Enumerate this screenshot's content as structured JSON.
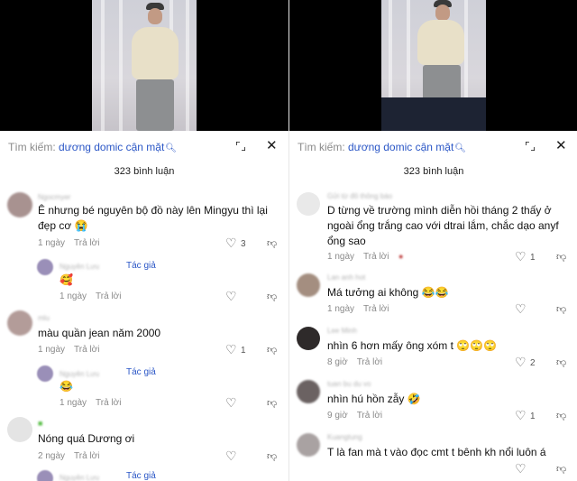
{
  "left": {
    "search": {
      "prefix": "Tìm kiếm: ",
      "query": "dương domic cận mặt"
    },
    "comment_count": "323 bình luận",
    "comments": [
      {
        "username": "Ngocmyer",
        "text_line1": "Ê nhưng bé nguyên bộ đồ này lên Mingyu thì lại",
        "text_line2": "đẹp cơ 😭",
        "time": "1 ngày",
        "reply": "Trả lời",
        "likes": "3"
      },
      {
        "username": "Nguyên Lưu",
        "author_tag": "Tác giả",
        "text": "🥰",
        "time": "1 ngày",
        "reply": "Trả lời"
      },
      {
        "username": "mlu",
        "text": "màu quần jean năm 2000",
        "time": "1 ngày",
        "reply": "Trả lời",
        "likes": "1"
      },
      {
        "username": "Nguyên Lưu",
        "author_tag": "Tác giả",
        "text": "😂",
        "time": "1 ngày",
        "reply": "Trả lời"
      },
      {
        "username": "",
        "text": "Nóng quá Dương ơi",
        "time": "2 ngày",
        "reply": "Trả lời"
      },
      {
        "username": "Nguyên Lưu",
        "author_tag": "Tác giả"
      }
    ]
  },
  "right": {
    "search": {
      "prefix": "Tìm kiếm: ",
      "query": "dương domic cận mặt"
    },
    "comment_count": "323 bình luận",
    "comments": [
      {
        "username": "Gửi từ đô thông báo",
        "text_line1": "D từng về trường mình diễn hồi tháng 2 thấy ở",
        "text_line2": "ngoài ổng trắng cao với dtrai lắm, chắc dạo anyf",
        "text_line3": "ổng sao",
        "time": "1 ngày",
        "reply": "Trả lời",
        "likes": "1"
      },
      {
        "username": "Lan anh hot",
        "text": "Má tưởng ai không 😂😂",
        "time": "1 ngày",
        "reply": "Trả lời"
      },
      {
        "username": "Lee Minh",
        "text": "nhìn 6 hơn mấy ông xóm t 🙄🙄🙄",
        "time": "8 giờ",
        "reply": "Trả lời",
        "likes": "2"
      },
      {
        "username": "tuan bu du vo",
        "text": "nhìn hú hồn zẫy 🤣",
        "time": "9 giờ",
        "reply": "Trả lời",
        "likes": "1"
      },
      {
        "username": "Kuangtung",
        "text": "T là fan mà t vào đọc cmt t bênh kh nổi luôn á"
      }
    ]
  },
  "colors": {
    "link_blue": "#2a56c6",
    "meta_gray": "#8a8a8a"
  },
  "icons": [
    "expand-icon",
    "close-icon",
    "heart-icon",
    "dislike-icon"
  ]
}
